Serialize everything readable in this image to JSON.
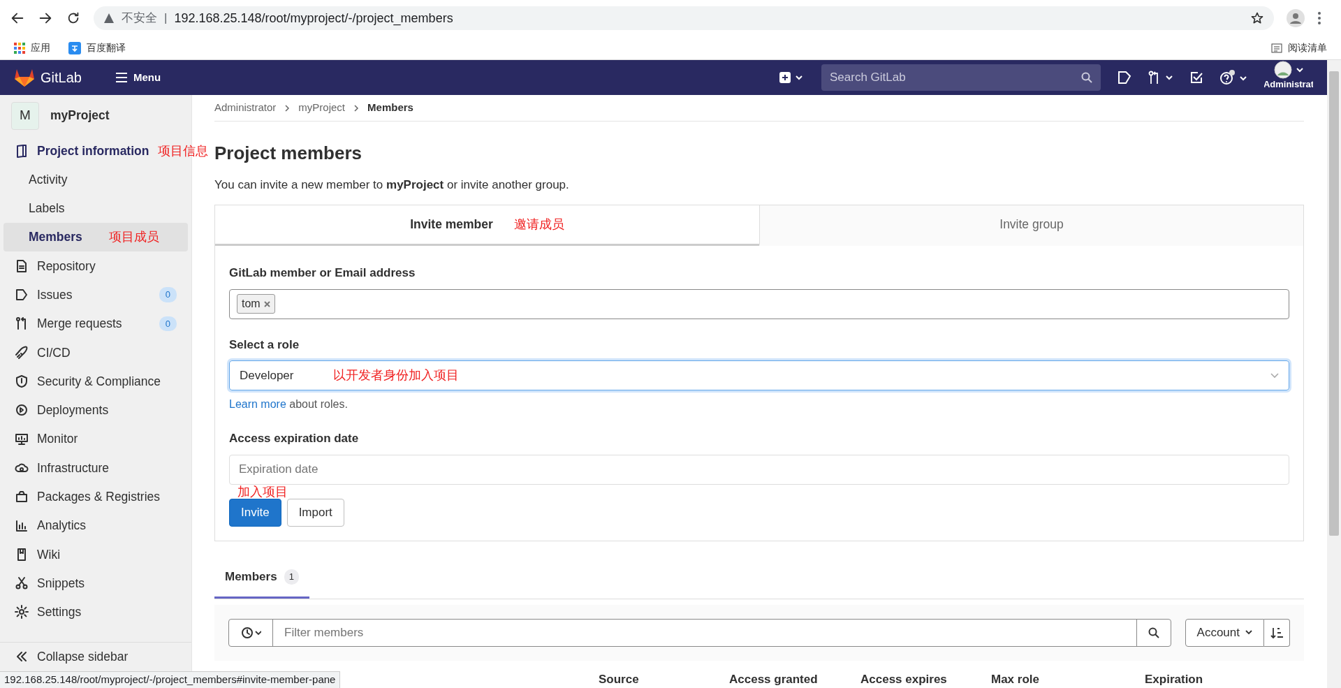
{
  "browser": {
    "security_label": "不安全",
    "separator": "|",
    "url": "192.168.25.148/root/myproject/-/project_members",
    "bookmarks": [
      {
        "label": "应用"
      },
      {
        "label": "百度翻译"
      }
    ],
    "reading_list": "阅读清单"
  },
  "navbar": {
    "logo_text": "GitLab",
    "menu_label": "Menu",
    "search_placeholder": "Search GitLab",
    "user_label": "Administrat"
  },
  "sidebar": {
    "project": {
      "avatar_letter": "M",
      "name": "myProject"
    },
    "items": [
      {
        "label": "Project information",
        "expanded": true,
        "selected": false,
        "annotation": "项目信息",
        "children": [
          {
            "label": "Activity",
            "selected": false
          },
          {
            "label": "Labels",
            "selected": false
          },
          {
            "label": "Members",
            "selected": true,
            "annotation": "项目成员"
          }
        ]
      },
      {
        "label": "Repository",
        "selected": false
      },
      {
        "label": "Issues",
        "badge": "0",
        "selected": false
      },
      {
        "label": "Merge requests",
        "badge": "0",
        "selected": false
      },
      {
        "label": "CI/CD",
        "selected": false
      },
      {
        "label": "Security & Compliance",
        "selected": false
      },
      {
        "label": "Deployments",
        "selected": false
      },
      {
        "label": "Monitor",
        "selected": false
      },
      {
        "label": "Infrastructure",
        "selected": false
      },
      {
        "label": "Packages & Registries",
        "selected": false
      },
      {
        "label": "Analytics",
        "selected": false
      },
      {
        "label": "Wiki",
        "selected": false
      },
      {
        "label": "Snippets",
        "selected": false
      },
      {
        "label": "Settings",
        "selected": false
      }
    ],
    "collapse_label": "Collapse sidebar"
  },
  "breadcrumbs": [
    "Administrator",
    "myProject",
    "Members"
  ],
  "title": "Project members",
  "description": "You can invite a new member to **myProject** or invite another group.",
  "invite_tabs": [
    {
      "label": "Invite member",
      "selected": true,
      "annotation": "邀请成员"
    },
    {
      "label": "Invite group",
      "selected": false
    }
  ],
  "form": {
    "member_label": "GitLab member or Email address",
    "tokens": [
      "tom"
    ],
    "role_label": "Select a role",
    "role_value": "Developer",
    "role_annotation": "以开发者身份加入项目",
    "help_link": "Learn more",
    "help_text": "about roles.",
    "expiration_label": "Access expiration date",
    "expiration_placeholder": "Expiration date",
    "expiration_annotation": "加入项目",
    "buttons": [
      {
        "label": "Invite",
        "kind": "primary"
      },
      {
        "label": "Import",
        "kind": "secondary"
      }
    ]
  },
  "member_tabs": [
    {
      "label": "Members",
      "count": "1",
      "selected": true
    }
  ],
  "filter": {
    "placeholder": "Filter members",
    "sort_label": "Account"
  },
  "table": {
    "columns": [
      "Source",
      "Access granted",
      "Access expires",
      "Max role",
      "Expiration"
    ]
  },
  "status_bar": "192.168.25.148/root/myproject/-/project_members#invite-member-pane"
}
